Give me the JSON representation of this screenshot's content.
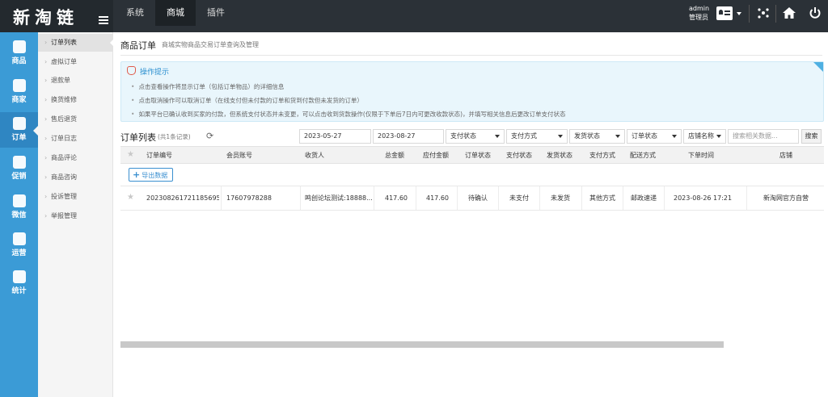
{
  "logo": {
    "text": "新淘链"
  },
  "topnav": [
    {
      "label": "系统",
      "active": false
    },
    {
      "label": "商城",
      "active": true
    },
    {
      "label": "插件",
      "active": false
    }
  ],
  "user": {
    "name": "admin",
    "role": "管理员"
  },
  "leftbar": [
    {
      "label": "商品",
      "icon": "bag-icon"
    },
    {
      "label": "商家",
      "icon": "store-icon"
    },
    {
      "label": "订单",
      "icon": "order-icon",
      "active": true
    },
    {
      "label": "促销",
      "icon": "gift-icon"
    },
    {
      "label": "微信",
      "icon": "wechat-icon"
    },
    {
      "label": "运营",
      "icon": "operate-icon"
    },
    {
      "label": "统计",
      "icon": "chart-icon"
    }
  ],
  "subnav": [
    {
      "label": "订单列表",
      "active": true
    },
    {
      "label": "虚拟订单"
    },
    {
      "label": "退款单"
    },
    {
      "label": "换货维修"
    },
    {
      "label": "售后退货"
    },
    {
      "label": "订单日志"
    },
    {
      "label": "商品评论"
    },
    {
      "label": "商品咨询"
    },
    {
      "label": "投诉管理"
    },
    {
      "label": "举报管理"
    }
  ],
  "page": {
    "title": "商品订单",
    "subtitle": "商城实物商品交易订单查询及管理"
  },
  "tips": {
    "title": "操作提示",
    "lines": [
      "点击查看操作将显示订单（包括订单物品）的详细信息",
      "点击取消操作可以取消订单（在线支付但未付款的订单和货到付款但未发货的订单）",
      "如果平台已确认收到买家的付款，但系统支付状态并未变更，可以点击收到货款操作(仅限于下单后7日内可更改收款状态)，并填写相关信息后更改订单支付状态"
    ]
  },
  "list": {
    "title": "订单列表",
    "count": "(共1条记录)",
    "filters": {
      "date_start": "2023-05-27",
      "date_end": "2023-08-27",
      "pay_status": "支付状态",
      "pay_method": "支付方式",
      "ship_status": "发货状态",
      "order_status": "订单状态",
      "shop_name": "店铺名称",
      "search_placeholder": "搜索相关数据...",
      "search_button": "搜索"
    },
    "export_button": "导出数据",
    "columns": [
      "订单编号",
      "会员账号",
      "收货人",
      "总金额",
      "应付金额",
      "订单状态",
      "支付状态",
      "发货状态",
      "支付方式",
      "配送方式",
      "下单时间",
      "店铺"
    ],
    "rows": [
      {
        "order_no": "202308261721185695",
        "member": "17607978288",
        "receiver": "鸣创论坛测试:18888...",
        "total": "417.60",
        "payable": "417.60",
        "order_status": "待确认",
        "pay_status": "未支付",
        "ship_status": "未发货",
        "pay_method": "其他方式",
        "delivery": "邮政速递",
        "time": "2023-08-26 17:21",
        "shop": "新淘网官方自营"
      }
    ]
  }
}
